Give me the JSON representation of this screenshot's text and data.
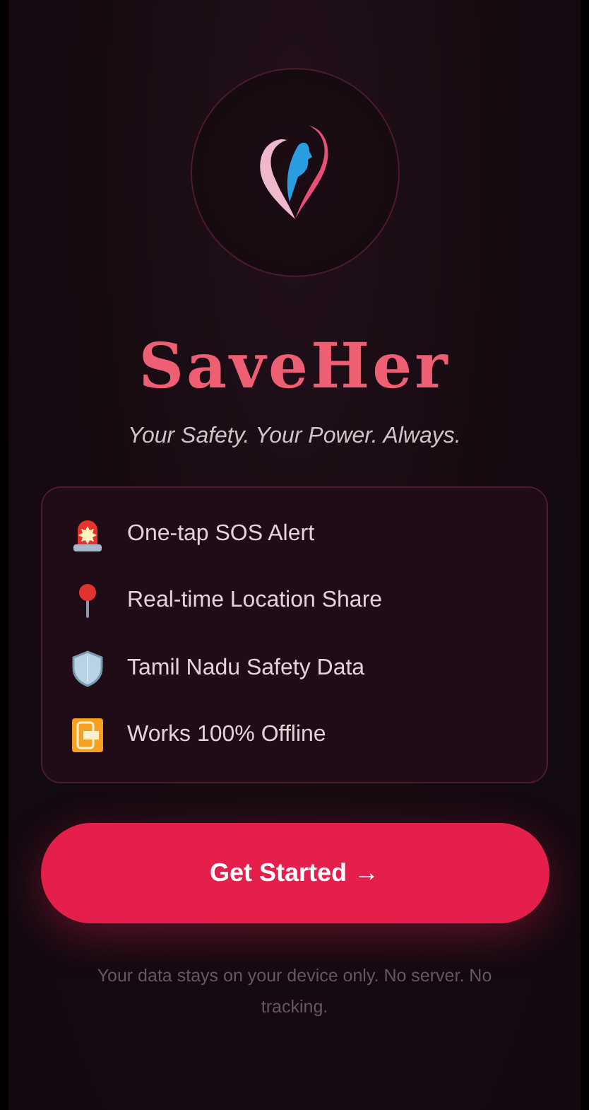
{
  "app": {
    "title": "SaveHer",
    "tagline": "Your Safety. Your Power. Always."
  },
  "features": [
    {
      "kind": "siren",
      "label": "One-tap SOS Alert"
    },
    {
      "kind": "pin",
      "label": "Real-time Location Share"
    },
    {
      "kind": "shield",
      "label": "Tamil Nadu Safety Data"
    },
    {
      "kind": "offline",
      "label": "Works 100% Offline"
    }
  ],
  "button": {
    "label": "Get Started →"
  },
  "footer": "Your data stays on your device only. No server. No tracking."
}
